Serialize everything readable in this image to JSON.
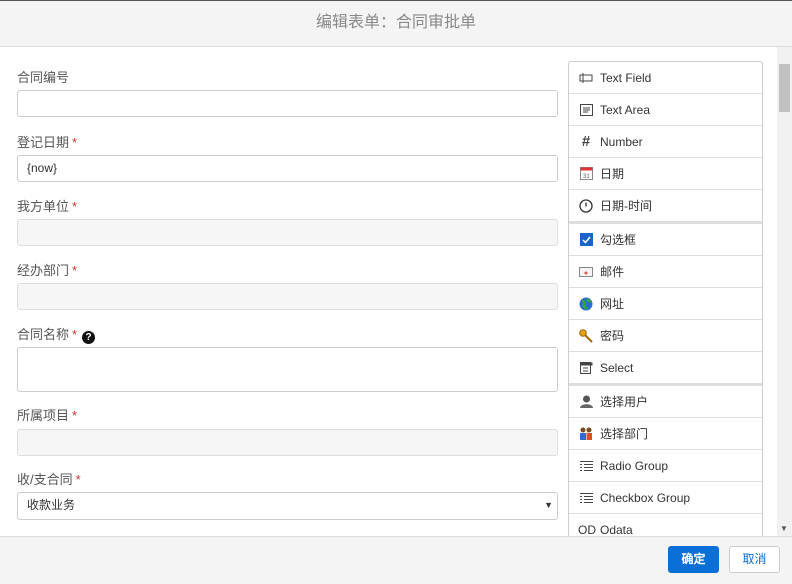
{
  "dialog": {
    "title": "编辑表单：合同审批单"
  },
  "form": {
    "fields": [
      {
        "label": "合同编号",
        "required": false,
        "value": "",
        "disabled": false
      },
      {
        "label": "登记日期",
        "required": true,
        "value": "{now}",
        "disabled": false
      },
      {
        "label": "我方单位",
        "required": true,
        "value": "",
        "disabled": true
      },
      {
        "label": "经办部门",
        "required": true,
        "value": "",
        "disabled": true
      },
      {
        "label": "合同名称",
        "required": true,
        "value": "",
        "help_icon": "question-circle-icon",
        "type": "textarea"
      },
      {
        "label": "所属项目",
        "required": true,
        "value": "",
        "disabled": true
      },
      {
        "label": "收/支合同",
        "required": true,
        "value": "收款业务",
        "type": "select"
      }
    ],
    "required_mark": "*",
    "help_glyph": "?"
  },
  "palette": {
    "items": [
      {
        "label": "Text Field",
        "icon": "text-field-icon"
      },
      {
        "label": "Text Area",
        "icon": "text-area-icon"
      },
      {
        "label": "Number",
        "icon": "hash-icon"
      },
      {
        "label": "日期",
        "icon": "calendar-icon"
      },
      {
        "label": "日期-时间",
        "icon": "clock-icon"
      },
      {
        "label": "勾选框",
        "icon": "checkbox-icon"
      },
      {
        "label": "邮件",
        "icon": "envelope-icon"
      },
      {
        "label": "网址",
        "icon": "globe-icon"
      },
      {
        "label": "密码",
        "icon": "key-icon"
      },
      {
        "label": "Select",
        "icon": "select-icon"
      },
      {
        "label": "选择用户",
        "icon": "user-icon"
      },
      {
        "label": "选择部门",
        "icon": "users-icon"
      },
      {
        "label": "Radio Group",
        "icon": "list-icon"
      },
      {
        "label": "Checkbox Group",
        "icon": "list-icon"
      },
      {
        "label": "Odata",
        "icon": "od-icon",
        "prefix": "OD"
      }
    ]
  },
  "footer": {
    "ok_label": "确定",
    "cancel_label": "取消"
  },
  "colors": {
    "primary": "#0a6fd6",
    "required": "#cc3333"
  }
}
